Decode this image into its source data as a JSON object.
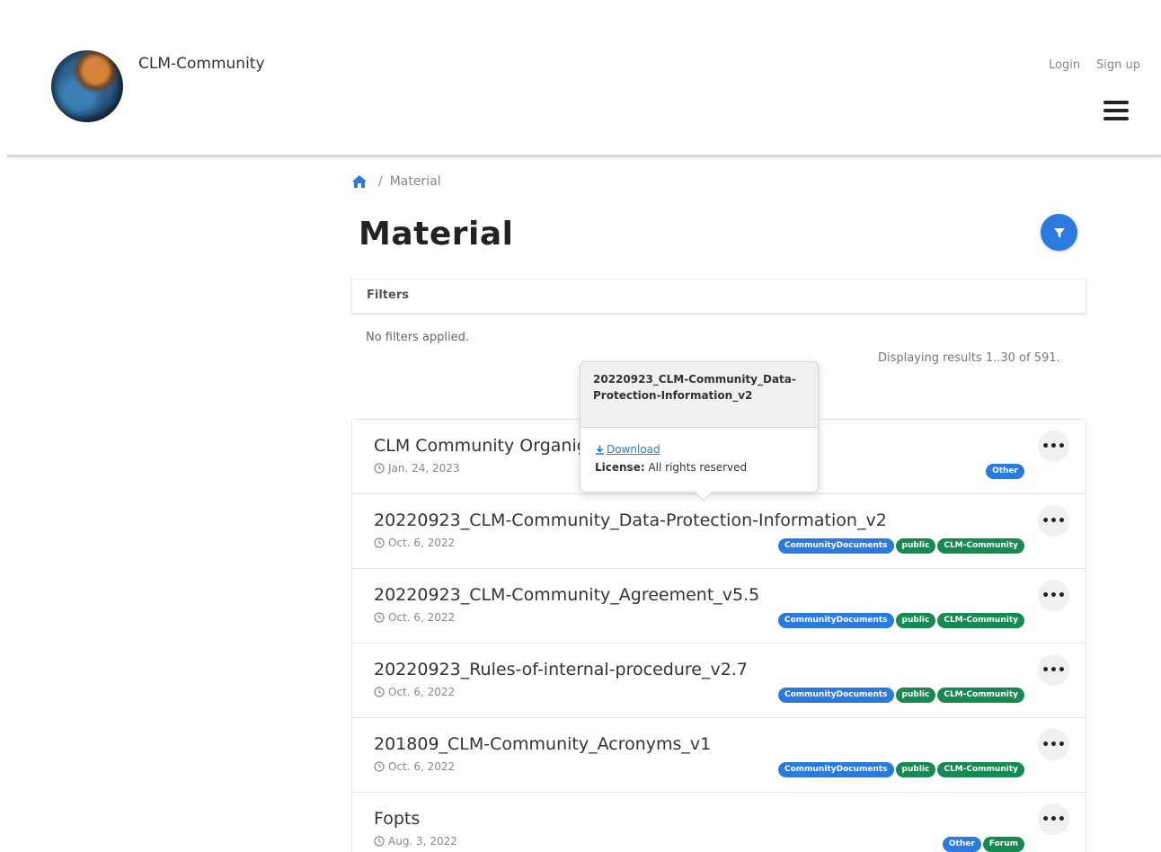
{
  "header": {
    "site_name": "CLM-Community",
    "login_label": "Login",
    "signup_label": "Sign up",
    "menu_icon": "hamburger-icon",
    "logo_icon": "globe-logo"
  },
  "breadcrumb": {
    "home_icon": "home-icon",
    "separator": "/",
    "current": "Material"
  },
  "page": {
    "title": "Material",
    "filter_button_icon": "filter-icon"
  },
  "filters": {
    "heading": "Filters",
    "status": "No filters applied.",
    "result_count": "Displaying results 1..30 of 591."
  },
  "popover": {
    "title": "20220923_CLM-Community_Data-Protection-Information_v2",
    "download_label": "Download",
    "license_key": "License:",
    "license_value": "All rights reserved"
  },
  "items": [
    {
      "title": "CLM Community Organigram",
      "date": "Jan. 24, 2023",
      "badges": [
        {
          "label": "Other",
          "color": "#2b7ae0"
        }
      ]
    },
    {
      "title": "20220923_CLM-Community_Data-Protection-Information_v2",
      "date": "Oct. 6, 2022",
      "badges": [
        {
          "label": "CommunityDocuments",
          "color": "#2b7ae0"
        },
        {
          "label": "public",
          "color": "#178a52"
        },
        {
          "label": "CLM-Community",
          "color": "#178a52"
        }
      ]
    },
    {
      "title": "20220923_CLM-Community_Agreement_v5.5",
      "date": "Oct. 6, 2022",
      "badges": [
        {
          "label": "CommunityDocuments",
          "color": "#2b7ae0"
        },
        {
          "label": "public",
          "color": "#178a52"
        },
        {
          "label": "CLM-Community",
          "color": "#178a52"
        }
      ]
    },
    {
      "title": "20220923_Rules-of-internal-procedure_v2.7",
      "date": "Oct. 6, 2022",
      "badges": [
        {
          "label": "CommunityDocuments",
          "color": "#2b7ae0"
        },
        {
          "label": "public",
          "color": "#178a52"
        },
        {
          "label": "CLM-Community",
          "color": "#178a52"
        }
      ]
    },
    {
      "title": "201809_CLM-Community_Acronyms_v1",
      "date": "Oct. 6, 2022",
      "badges": [
        {
          "label": "CommunityDocuments",
          "color": "#2b7ae0"
        },
        {
          "label": "public",
          "color": "#178a52"
        },
        {
          "label": "CLM-Community",
          "color": "#178a52"
        }
      ]
    },
    {
      "title": "Fopts",
      "date": "Aug. 3, 2022",
      "badges": [
        {
          "label": "Other",
          "color": "#2b7ae0"
        },
        {
          "label": "Forum",
          "color": "#178a52"
        }
      ]
    }
  ],
  "item_actions": {
    "more_label": "•••",
    "more_icon": "more-horizontal-icon",
    "date_icon": "clock-icon"
  }
}
